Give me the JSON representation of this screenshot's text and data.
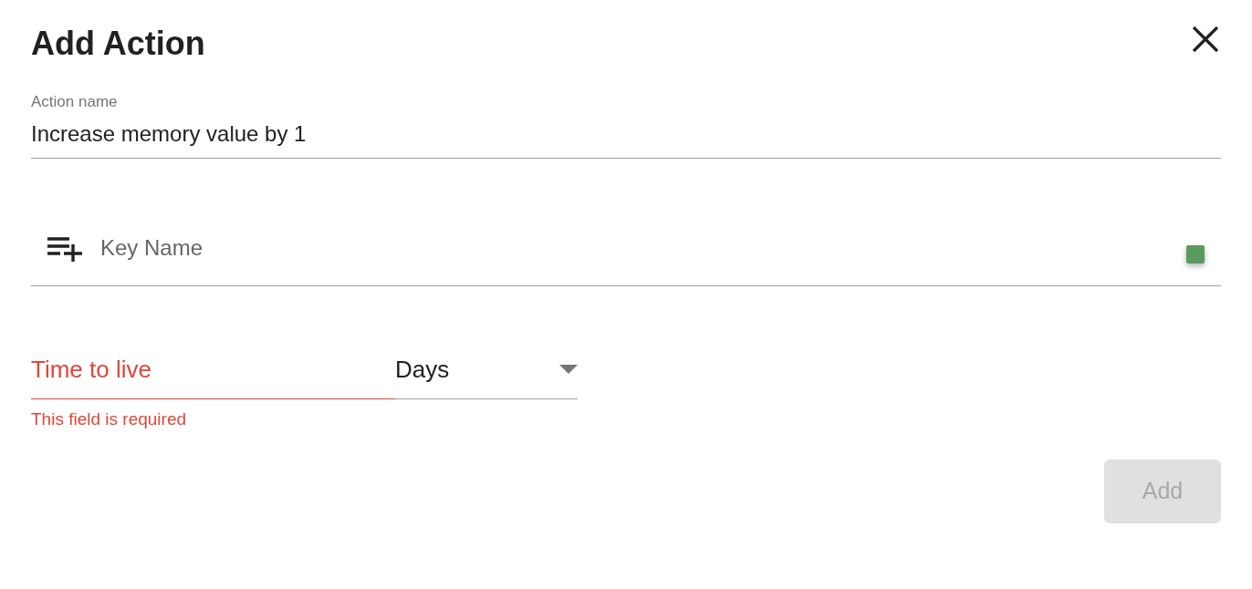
{
  "dialog": {
    "title": "Add Action"
  },
  "action_name": {
    "label": "Action name",
    "value": "Increase memory value by 1"
  },
  "key_name": {
    "placeholder": "Key Name"
  },
  "time_to_live": {
    "placeholder": "Time to live",
    "invalid": true,
    "error": "This field is required"
  },
  "unit": {
    "value": "Days"
  },
  "add_button": {
    "label": "Add",
    "disabled": true
  }
}
